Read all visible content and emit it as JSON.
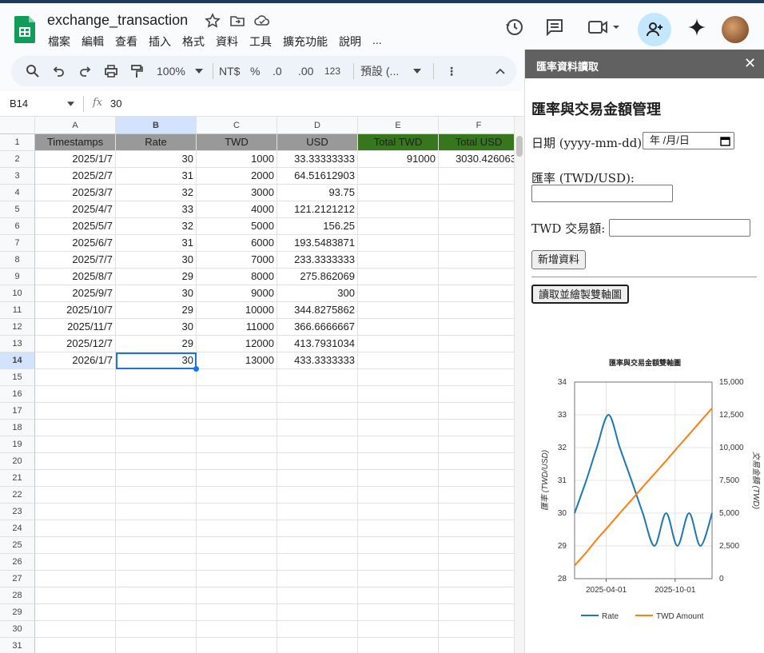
{
  "app": {
    "doc_title": "exchange_transaction",
    "menu": [
      "檔案",
      "編輯",
      "查看",
      "插入",
      "格式",
      "資料",
      "工具",
      "擴充功能",
      "說明",
      "..."
    ],
    "icons": [
      "history-icon",
      "comment-icon",
      "video-icon",
      "add-person-icon",
      "gemini-icon"
    ],
    "accent_color": "#c2e7ff"
  },
  "toolbar": {
    "zoom": "100%",
    "currency": "NT$",
    "percent": "%",
    "dec_less": ".0",
    "dec_more": ".00",
    "number_format": "123",
    "font": "預設 (...",
    "more": "⋮"
  },
  "formula": {
    "name_box": "B14",
    "fx": "fx",
    "value": "30"
  },
  "sheet": {
    "col_letters": [
      "A",
      "B",
      "C",
      "D",
      "E",
      "F"
    ],
    "row_numbers": [
      "1",
      "2",
      "3",
      "4",
      "5",
      "6",
      "7",
      "8",
      "9",
      "10",
      "11",
      "12",
      "13",
      "14",
      "15",
      "16",
      "17",
      "18",
      "19",
      "20",
      "21",
      "22",
      "23",
      "24",
      "25",
      "26",
      "27",
      "28",
      "29",
      "30",
      "31"
    ],
    "headers": [
      "Timestamps",
      "Rate",
      "TWD",
      "USD",
      "Total TWD",
      "Total USD"
    ],
    "rows": [
      [
        "2025/1/7",
        "30",
        "1000",
        "33.33333333",
        "91000",
        "3030.426063"
      ],
      [
        "2025/2/7",
        "31",
        "2000",
        "64.51612903",
        "",
        ""
      ],
      [
        "2025/3/7",
        "32",
        "3000",
        "93.75",
        "",
        ""
      ],
      [
        "2025/4/7",
        "33",
        "4000",
        "121.2121212",
        "",
        ""
      ],
      [
        "2025/5/7",
        "32",
        "5000",
        "156.25",
        "",
        ""
      ],
      [
        "2025/6/7",
        "31",
        "6000",
        "193.5483871",
        "",
        ""
      ],
      [
        "2025/7/7",
        "30",
        "7000",
        "233.3333333",
        "",
        ""
      ],
      [
        "2025/8/7",
        "29",
        "8000",
        "275.862069",
        "",
        ""
      ],
      [
        "2025/9/7",
        "30",
        "9000",
        "300",
        "",
        ""
      ],
      [
        "2025/10/7",
        "29",
        "10000",
        "344.8275862",
        "",
        ""
      ],
      [
        "2025/11/7",
        "30",
        "11000",
        "366.6666667",
        "",
        ""
      ],
      [
        "2025/12/7",
        "29",
        "12000",
        "413.7931034",
        "",
        ""
      ],
      [
        "2026/1/7",
        "30",
        "13000",
        "433.3333333",
        "",
        ""
      ]
    ],
    "header_gray": "#999999",
    "header_green": "#38761d",
    "selection_color": "#1a73e8"
  },
  "panel": {
    "header": "匯率資料讀取",
    "close": "✕",
    "title": "匯率與交易金額管理",
    "date_label": "日期 (yyyy-mm-dd):",
    "date_placeholder": "年 /月/日",
    "rate_label": "匯率 (TWD/USD):",
    "twd_label": "TWD 交易額:",
    "add_button": "新增資料",
    "read_button": "讀取並繪製雙軸圖"
  },
  "chart_data": {
    "type": "line",
    "title": "匯率與交易金額雙軸圖",
    "x": [
      "2025-01-07",
      "2025-02-07",
      "2025-03-07",
      "2025-04-07",
      "2025-05-07",
      "2025-06-07",
      "2025-07-07",
      "2025-08-07",
      "2025-09-07",
      "2025-10-07",
      "2025-11-07",
      "2025-12-07",
      "2026-01-07"
    ],
    "x_ticks": [
      "2025-04-01",
      "2025-10-01"
    ],
    "series": [
      {
        "name": "Rate",
        "axis": "left",
        "color": "#1f77b4",
        "values": [
          30,
          31,
          32,
          33,
          32,
          31,
          30,
          29,
          30,
          29,
          30,
          29,
          30
        ]
      },
      {
        "name": "TWD Amount",
        "axis": "right",
        "color": "#ff7f0e",
        "values": [
          1000,
          2000,
          3000,
          4000,
          5000,
          6000,
          7000,
          8000,
          9000,
          10000,
          11000,
          12000,
          13000
        ]
      }
    ],
    "ylabel_left": "匯率 (TWD/USD)",
    "ylabel_right": "交易金額 (TWD)",
    "ylim_left": [
      28,
      34
    ],
    "yticks_left": [
      "28",
      "29",
      "30",
      "31",
      "32",
      "33",
      "34"
    ],
    "ylim_right": [
      0,
      15000
    ],
    "yticks_right": [
      "0",
      "2,500",
      "5,000",
      "7,500",
      "10,000",
      "12,500",
      "15,000"
    ],
    "grid": true,
    "legend": "bottom"
  }
}
